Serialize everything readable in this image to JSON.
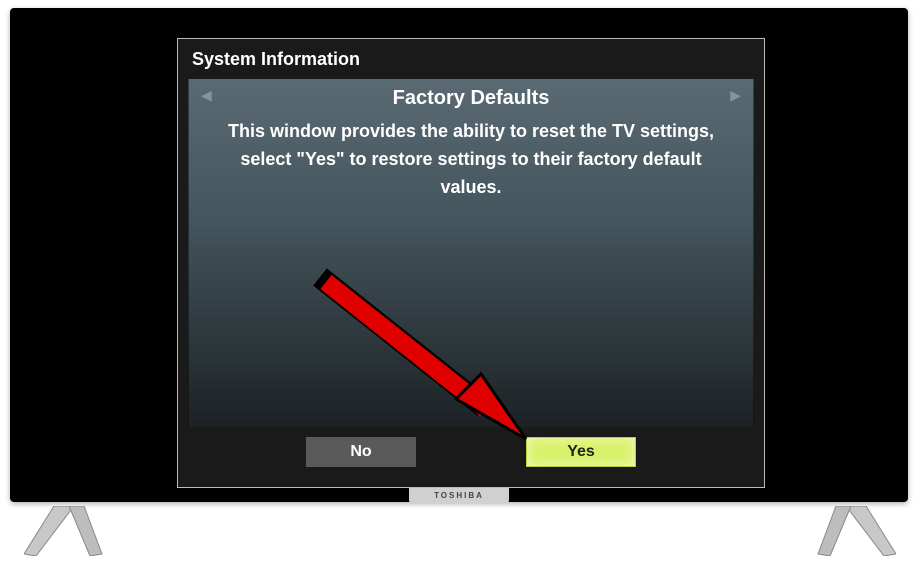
{
  "brand": "TOSHIBA",
  "dialog": {
    "title": "System Information",
    "section_title": "Factory Defaults",
    "description": "This window provides the ability to reset the TV settings, select \"Yes\" to restore settings to their factory default values.",
    "buttons": {
      "no_label": "No",
      "yes_label": "Yes"
    }
  }
}
